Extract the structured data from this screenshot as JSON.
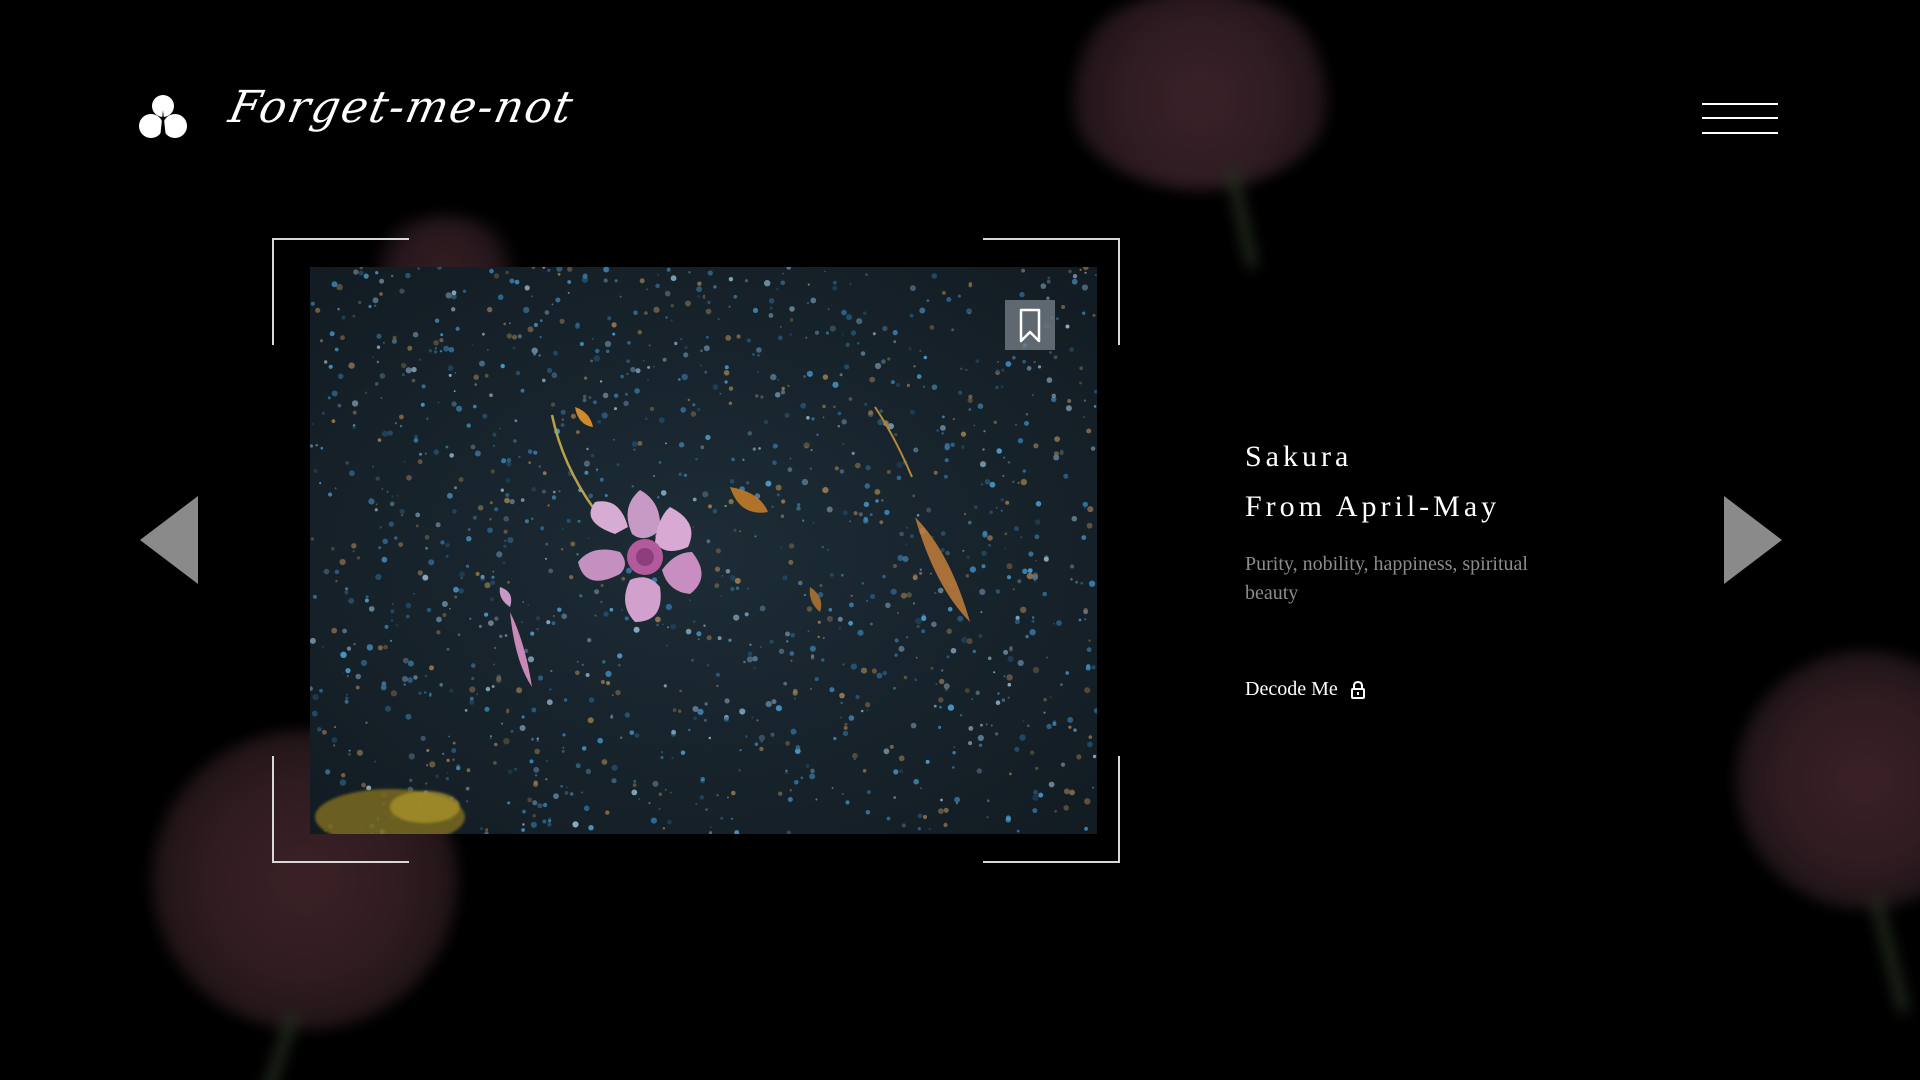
{
  "brand": {
    "name": "Forget-me-not",
    "logo_icon": "clover-icon"
  },
  "header": {
    "menu_icon": "hamburger-menu-icon"
  },
  "gallery": {
    "prev_icon": "arrow-left-icon",
    "next_icon": "arrow-right-icon",
    "bookmark_icon": "bookmark-icon",
    "image_subject": "pink-flower-on-speckled-ground"
  },
  "flower": {
    "title": "Sakura",
    "season": "From April-May",
    "meaning": "Purity, nobility, happiness, spiritual beauty",
    "action_label": "Decode Me",
    "action_icon": "lock-icon"
  },
  "colors": {
    "background": "#000000",
    "text_primary": "#ffffff",
    "text_muted": "#8c8c8c",
    "arrow": "#8a8a8a"
  }
}
